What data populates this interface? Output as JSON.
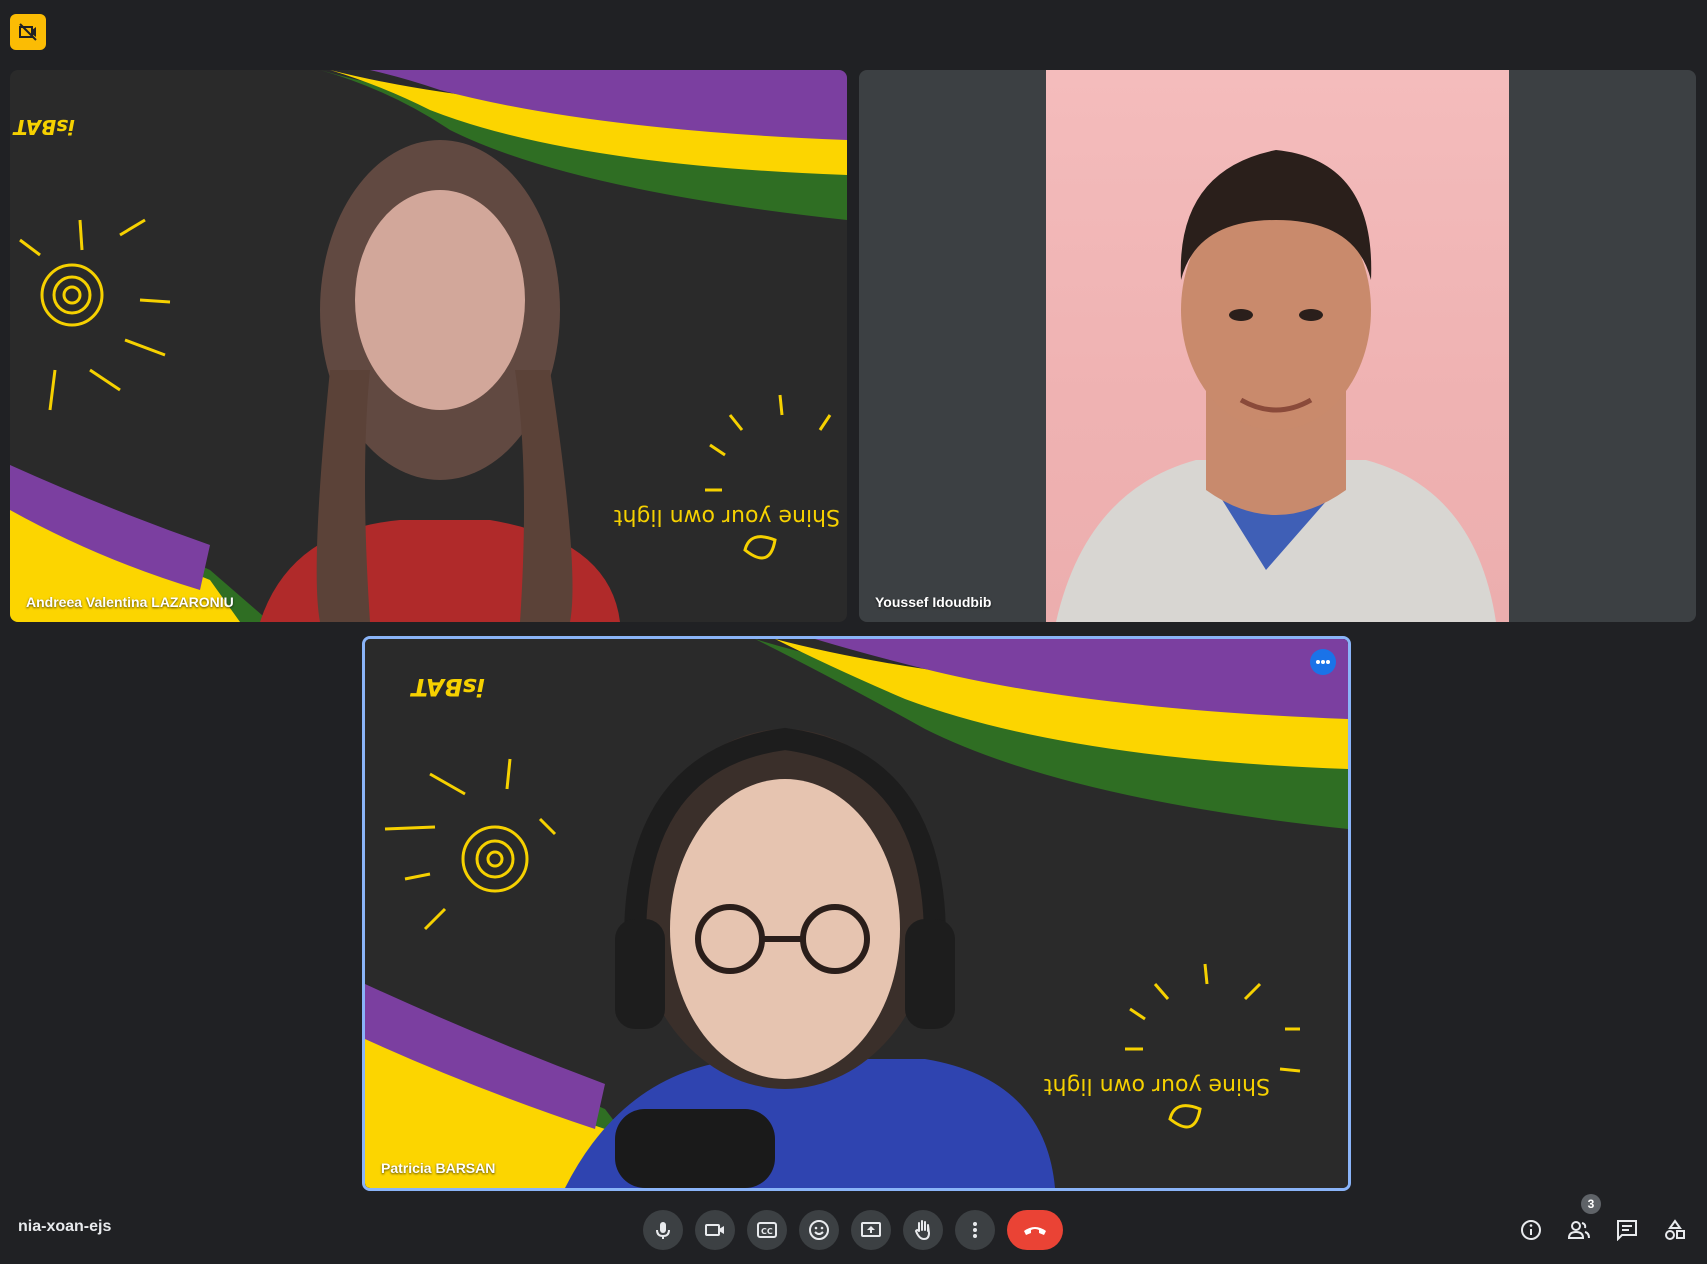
{
  "meeting": {
    "code": "nia-xoan-ejs",
    "participants_count": "3"
  },
  "tiles": {
    "andreea": {
      "name": "Andreea Valentina LAZARONIU"
    },
    "youssef": {
      "name": "Youssef Idoudbib"
    },
    "patricia": {
      "name": "Patricia BARSAN"
    }
  },
  "background_art": {
    "logo": "isBAT",
    "doodle_text": "Shine your own light"
  },
  "controls": [
    {
      "name": "microphone-icon"
    },
    {
      "name": "camera-icon"
    },
    {
      "name": "captions-icon"
    },
    {
      "name": "emoji-icon"
    },
    {
      "name": "present-screen-icon"
    },
    {
      "name": "raise-hand-icon"
    },
    {
      "name": "more-options-icon"
    },
    {
      "name": "end-call-icon"
    }
  ],
  "colors": {
    "background": "#202124",
    "control_bg": "#3c4043",
    "end_call": "#ea4335",
    "active_border": "#8ab4f8",
    "purple": "#7b3fa0",
    "yellow": "#fcd500",
    "green": "#2f6e23",
    "badge_yellow": "#fbbc04"
  }
}
